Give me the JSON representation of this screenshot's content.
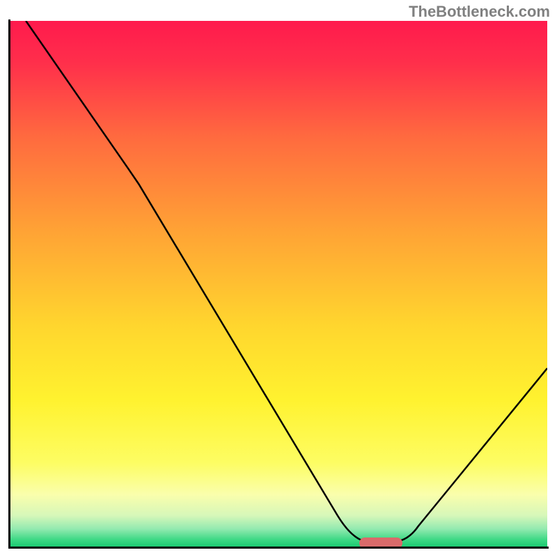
{
  "watermark": "TheBottleneck.com",
  "chart_data": {
    "type": "line",
    "title": "",
    "xlabel": "",
    "ylabel": "",
    "xlim": [
      0,
      100
    ],
    "ylim": [
      0,
      100
    ],
    "grid": false,
    "curve": {
      "points": [
        {
          "x": 3,
          "y": 100
        },
        {
          "x": 22,
          "y": 72
        },
        {
          "x": 63,
          "y": 3
        },
        {
          "x": 65,
          "y": 1
        },
        {
          "x": 73,
          "y": 1
        },
        {
          "x": 75,
          "y": 3
        },
        {
          "x": 100,
          "y": 34
        }
      ]
    },
    "marker": {
      "x_start": 65,
      "x_end": 73,
      "y": 0.8,
      "color": "#d96a6a"
    },
    "background_gradient": {
      "type": "vertical",
      "stops": [
        {
          "pos": 0.0,
          "color": "#ff1a4d"
        },
        {
          "pos": 0.08,
          "color": "#ff2f4b"
        },
        {
          "pos": 0.22,
          "color": "#ff6a3f"
        },
        {
          "pos": 0.4,
          "color": "#ffa335"
        },
        {
          "pos": 0.58,
          "color": "#ffd62e"
        },
        {
          "pos": 0.72,
          "color": "#fff22f"
        },
        {
          "pos": 0.84,
          "color": "#fdfd63"
        },
        {
          "pos": 0.9,
          "color": "#fafeac"
        },
        {
          "pos": 0.94,
          "color": "#d6f7b9"
        },
        {
          "pos": 0.965,
          "color": "#93eab0"
        },
        {
          "pos": 0.985,
          "color": "#3fd986"
        },
        {
          "pos": 1.0,
          "color": "#18c96f"
        }
      ]
    }
  }
}
